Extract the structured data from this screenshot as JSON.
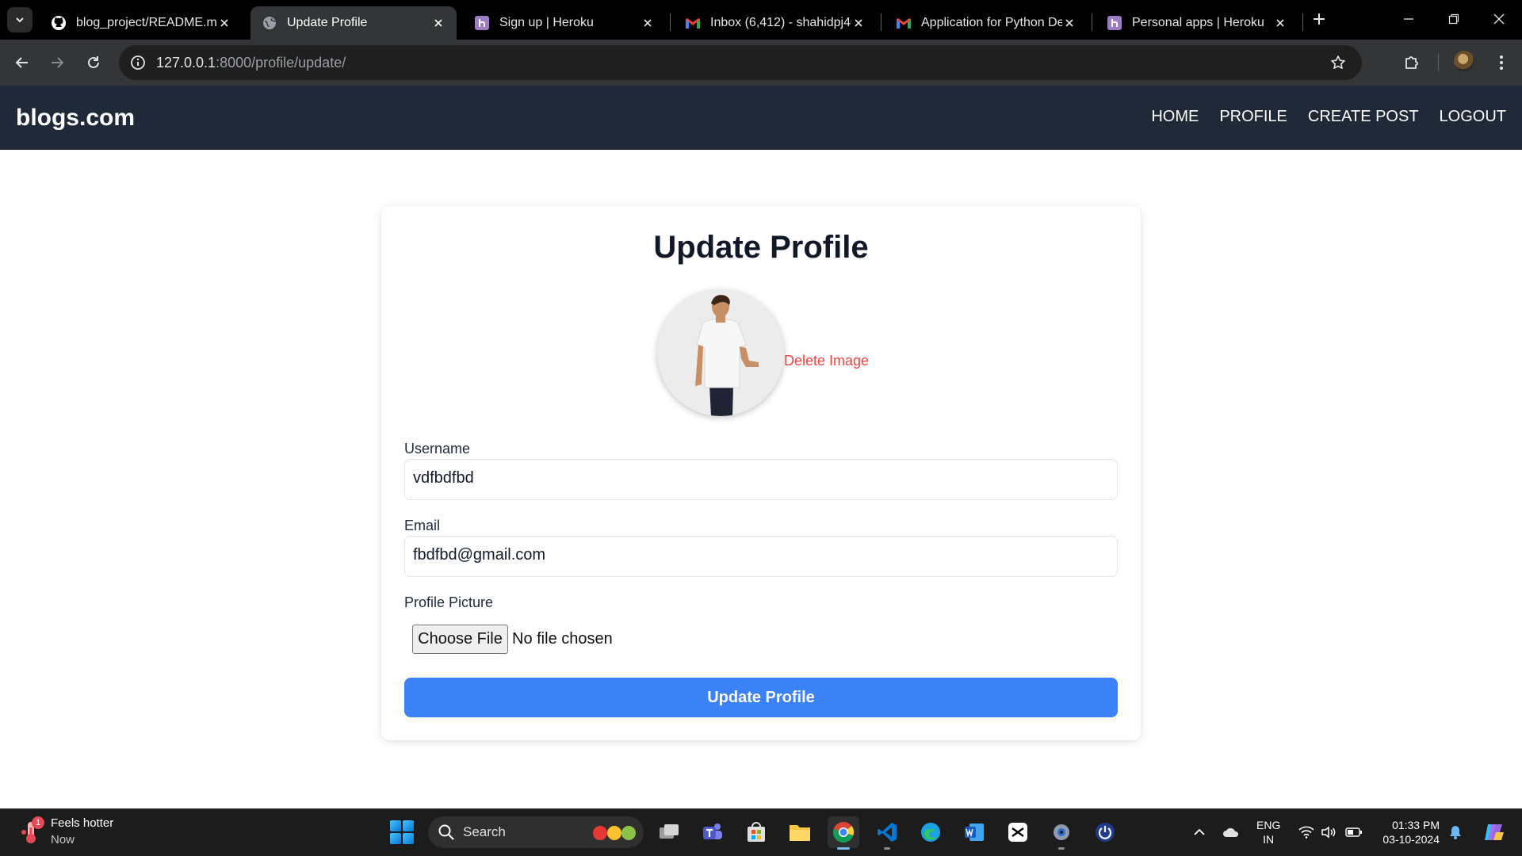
{
  "browser": {
    "tabs": [
      {
        "title": "blog_project/README.md",
        "icon": "github-icon"
      },
      {
        "title": "Update Profile",
        "icon": "globe-icon",
        "active": true
      },
      {
        "title": "Sign up | Heroku",
        "icon": "heroku-icon"
      },
      {
        "title": "Inbox (6,412) - shahidpj40(",
        "icon": "gmail-icon"
      },
      {
        "title": "Application for Python Dev",
        "icon": "gmail-icon"
      },
      {
        "title": "Personal apps | Heroku",
        "icon": "heroku-icon"
      }
    ],
    "url_host": "127.0.0.1",
    "url_rest": ":8000/profile/update/"
  },
  "site": {
    "brand": "blogs.com",
    "nav": {
      "home": "HOME",
      "profile": "PROFILE",
      "create_post": "CREATE POST",
      "logout": "LOGOUT"
    }
  },
  "form": {
    "title": "Update Profile",
    "delete_image": "Delete Image",
    "username_label": "Username",
    "username_value": "vdfbdfbd",
    "email_label": "Email",
    "email_value": "fbdfbd@gmail.com",
    "picture_label": "Profile Picture",
    "choose_file": "Choose File",
    "file_status": "No file chosen",
    "submit": "Update Profile"
  },
  "taskbar": {
    "weather_title": "Feels hotter",
    "weather_sub": "Now",
    "weather_badge": "1",
    "search_placeholder": "Search",
    "lang_top": "ENG",
    "lang_bottom": "IN",
    "time": "01:33 PM",
    "date": "03-10-2024"
  },
  "colors": {
    "navbar": "#1f2937",
    "primary_button": "#3b82f6",
    "delete_link": "#ef4444"
  }
}
